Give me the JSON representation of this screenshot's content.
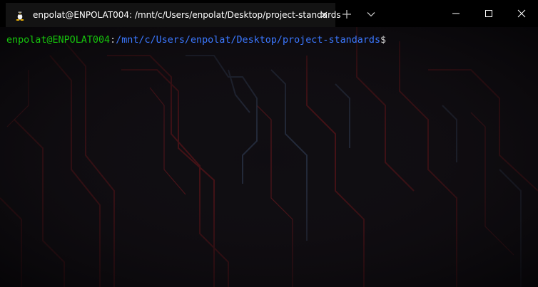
{
  "window": {
    "tab": {
      "title": "enpolat@ENPOLAT004: /mnt/c/Users/enpolat/Desktop/project-standards",
      "icon": "linux-penguin-icon"
    },
    "controls": {
      "new_tab_icon": "plus-icon",
      "dropdown_icon": "chevron-down-icon",
      "minimize_icon": "minimize-icon",
      "maximize_icon": "maximize-icon",
      "close_icon": "close-icon"
    }
  },
  "terminal": {
    "prompt": {
      "user_host": "enpolat@ENPOLAT004",
      "separator": ":",
      "path": "/mnt/c/Users/enpolat/Desktop/project-standards",
      "symbol": "$"
    }
  },
  "colors": {
    "user_host": "#16c60c",
    "path": "#3b78ff",
    "text": "#cccccc",
    "titlebar": "#000000",
    "active_tab": "#131313"
  }
}
